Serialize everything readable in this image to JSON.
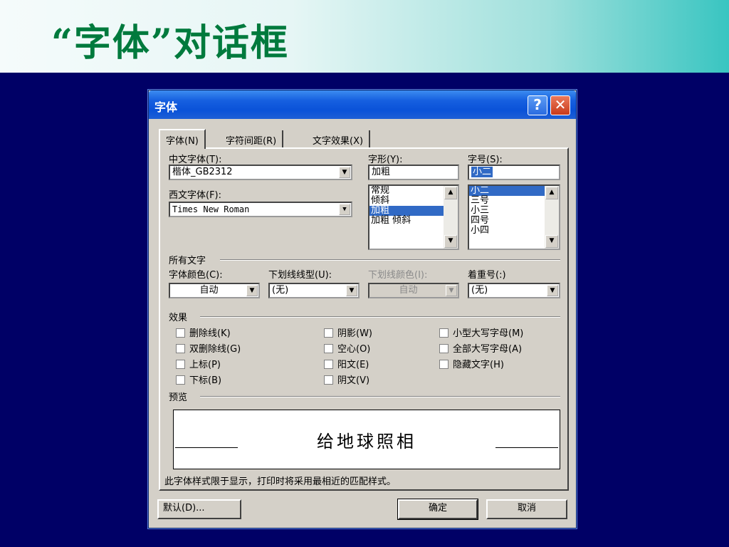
{
  "slide": {
    "title": "“字体”对话框"
  },
  "dialog": {
    "title": "字体",
    "help_label": "?",
    "close_label": "✕",
    "tabs": [
      "字体(N)",
      "字符间距(R)",
      "文字效果(X)"
    ],
    "font": {
      "chinese_label": "中文字体(T):",
      "chinese_value": "楷体_GB2312",
      "western_label": "西文字体(F):",
      "western_value": "Times New Roman",
      "style_label": "字形(Y):",
      "style_value": "加粗",
      "style_options": [
        "常规",
        "倾斜",
        "加粗",
        "加粗 倾斜"
      ],
      "style_selected": "加粗",
      "size_label": "字号(S):",
      "size_value": "小二",
      "size_options": [
        "小二",
        "三号",
        "小三",
        "四号",
        "小四"
      ],
      "size_selected": "小二"
    },
    "all_text": {
      "group_label": "所有文字",
      "color_label": "字体颜色(C):",
      "color_value": "自动",
      "underline_label": "下划线线型(U):",
      "underline_value": "(无)",
      "underline_color_label": "下划线颜色(I):",
      "underline_color_value": "自动",
      "emphasis_label": "着重号(:)",
      "emphasis_value": "(无)"
    },
    "effects": {
      "group_label": "效果",
      "col1": [
        "删除线(K)",
        "双删除线(G)",
        "上标(P)",
        "下标(B)"
      ],
      "col2": [
        "阴影(W)",
        "空心(O)",
        "阳文(E)",
        "阴文(V)"
      ],
      "col3": [
        "小型大写字母(M)",
        "全部大写字母(A)",
        "隐藏文字(H)"
      ]
    },
    "preview": {
      "group_label": "预览",
      "sample_text": "给地球照相",
      "note": "此字体样式限于显示，打印时将采用最相近的匹配样式。"
    },
    "buttons": {
      "default_label": "默认(D)...",
      "ok_label": "确定",
      "cancel_label": "取消"
    },
    "icons": {
      "dropdown": "▼",
      "scroll_up": "▲",
      "scroll_down": "▼"
    }
  }
}
